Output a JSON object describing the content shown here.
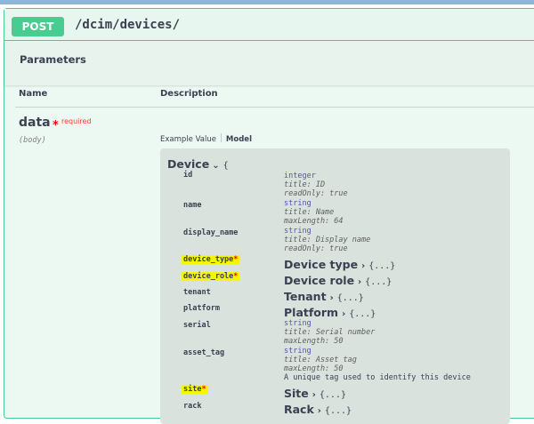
{
  "operation": {
    "method": "POST",
    "path": "/dcim/devices/"
  },
  "parameters": {
    "title": "Parameters",
    "col_name": "Name",
    "col_description": "Description",
    "param": {
      "name": "data",
      "required_mark": "*",
      "required_label": "required",
      "in": "(body)"
    }
  },
  "tabs": {
    "example": "Example Value",
    "model": "Model"
  },
  "model": {
    "name": "Device",
    "chevron": "⌄",
    "brace": "{",
    "fields": {
      "id": {
        "name": "id",
        "type": "integer",
        "meta1": "title: ID",
        "meta2": "readOnly: true"
      },
      "name": {
        "name": "name",
        "type": "string",
        "meta1": "title: Name",
        "meta2": "maxLength: 64"
      },
      "display_name": {
        "name": "display_name",
        "type": "string",
        "meta1": "title: Display name",
        "meta2": "readOnly: true"
      },
      "device_type": {
        "name": "device_type",
        "star": "*",
        "ref": "Device type",
        "chevron": "›",
        "brace": "{...}"
      },
      "device_role": {
        "name": "device_role",
        "star": "*",
        "ref": "Device role",
        "chevron": "›",
        "brace": "{...}"
      },
      "tenant": {
        "name": "tenant",
        "ref": "Tenant",
        "chevron": "›",
        "brace": "{...}"
      },
      "platform": {
        "name": "platform",
        "ref": "Platform",
        "chevron": "›",
        "brace": "{...}"
      },
      "serial": {
        "name": "serial",
        "type": "string",
        "meta1": "title: Serial number",
        "meta2": "maxLength: 50"
      },
      "asset_tag": {
        "name": "asset_tag",
        "type": "string",
        "meta1": "title: Asset tag",
        "meta2": "maxLength: 50",
        "desc": "A unique tag used to identify this device"
      },
      "site": {
        "name": "site",
        "star": "*",
        "ref": "Site",
        "chevron": "›",
        "brace": "{...}"
      },
      "rack": {
        "name": "rack",
        "ref": "Rack",
        "chevron": "›",
        "brace": "{...}"
      }
    }
  },
  "colors": {
    "post": "#49cc90",
    "highlight": "#f4f700",
    "required": "#ff0000"
  }
}
